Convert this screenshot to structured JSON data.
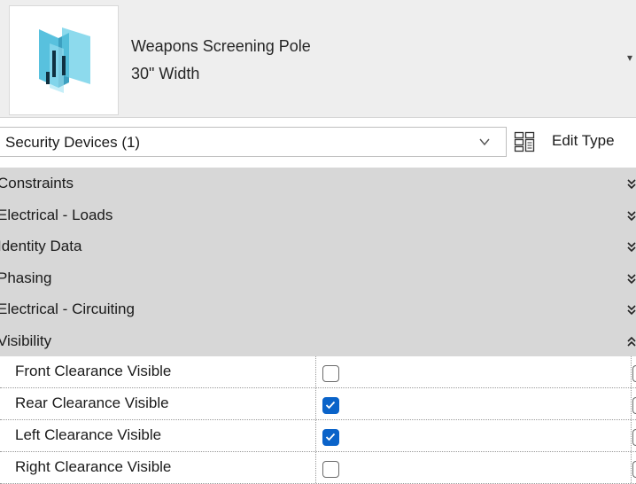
{
  "type_header": {
    "family_name": "Weapons Screening Pole",
    "type_name": "30\" Width",
    "thumbnail_icon": "weapons-screening-pole-icon"
  },
  "selector": {
    "value": "Security Devices (1)",
    "edit_type_label": "Edit Type",
    "edit_type_icon": "edit-type-icon"
  },
  "groups": [
    {
      "label": "Constraints",
      "expanded": false
    },
    {
      "label": "Electrical - Loads",
      "expanded": false
    },
    {
      "label": "Identity Data",
      "expanded": false
    },
    {
      "label": "Phasing",
      "expanded": false
    },
    {
      "label": "Electrical - Circuiting",
      "expanded": false
    },
    {
      "label": "Visibility",
      "expanded": true
    }
  ],
  "visibility_properties": [
    {
      "label": "Front Clearance Visible",
      "checked": false
    },
    {
      "label": "Rear Clearance Visible",
      "checked": true
    },
    {
      "label": "Left Clearance Visible",
      "checked": true
    },
    {
      "label": "Right Clearance Visible",
      "checked": false
    }
  ],
  "colors": {
    "accent": "#0a63c9",
    "group_background": "#d7d7d7",
    "header_background": "#eeeeee"
  }
}
